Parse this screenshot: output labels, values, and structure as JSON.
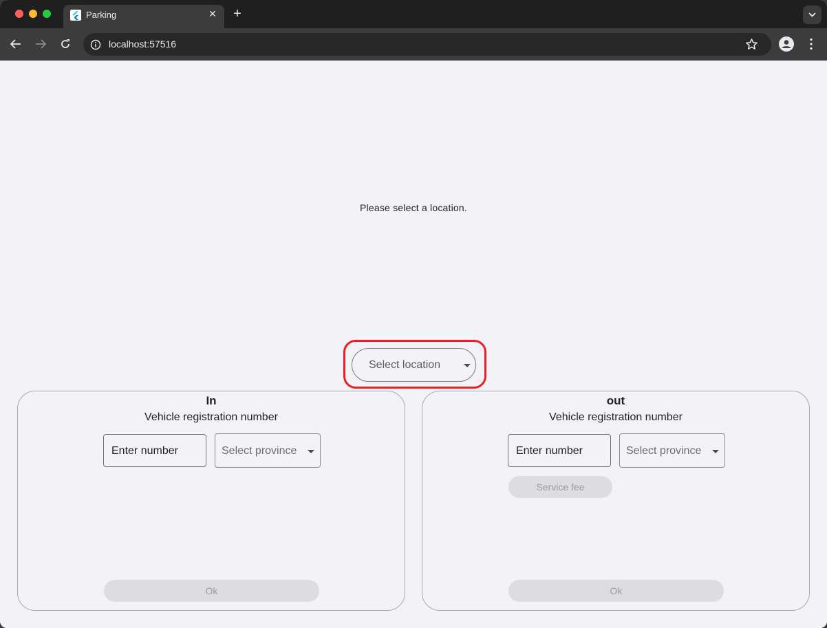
{
  "browser": {
    "tab_title": "Parking",
    "url": "localhost:57516",
    "icons": {
      "favicon": "flutter-logo-icon",
      "close": "close-icon",
      "new_tab": "plus-icon",
      "tab_menu": "chevron-down-icon",
      "back": "arrow-left-icon",
      "forward": "arrow-right-icon",
      "reload": "reload-icon",
      "site_info": "info-icon",
      "bookmark": "star-icon",
      "profile": "person-icon",
      "menu": "kebab-menu-icon"
    }
  },
  "page": {
    "prompt": "Please select a location.",
    "location_select": {
      "placeholder": "Select location",
      "highlight_color": "#ee1d23"
    },
    "panels": [
      {
        "title": "In",
        "subtitle": "Vehicle registration number",
        "number_placeholder": "Enter number",
        "province_placeholder": "Select province",
        "ok_label": "Ok"
      },
      {
        "title": "out",
        "subtitle": "Vehicle registration number",
        "number_placeholder": "Enter number",
        "province_placeholder": "Select province",
        "service_fee_label": "Service fee",
        "ok_label": "Ok"
      }
    ]
  }
}
